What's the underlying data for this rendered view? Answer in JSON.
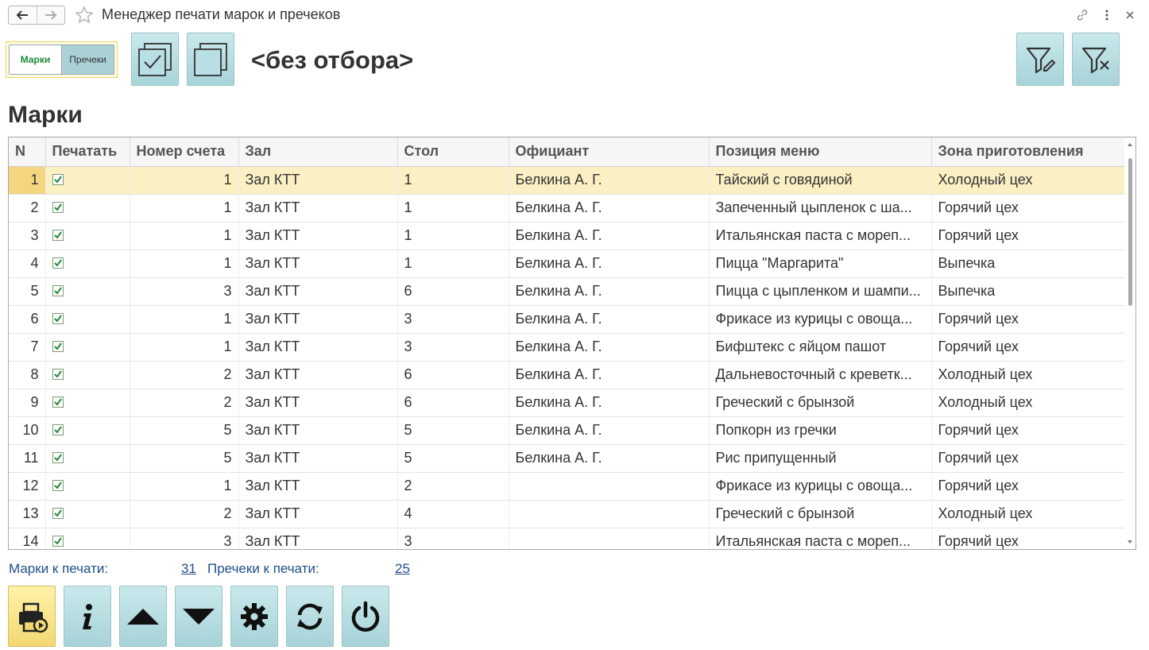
{
  "window": {
    "title": "Менеджер печати марок и пречеков"
  },
  "toolbar": {
    "toggle_marks": "Марки",
    "toggle_prechecks": "Пречеки",
    "filter_label": "<без отбора>"
  },
  "section": {
    "title": "Марки"
  },
  "table": {
    "columns": [
      "N",
      "Печатать",
      "Номер счета",
      "Зал",
      "Стол",
      "Официант",
      "Позиция меню",
      "Зона приготовления"
    ],
    "rows": [
      {
        "n": "1",
        "account": "1",
        "hall": "Зал КТТ",
        "table": "1",
        "waiter": "Белкина А. Г.",
        "item": "Тайский с говядиной",
        "zone": "Холодный цех"
      },
      {
        "n": "2",
        "account": "1",
        "hall": "Зал КТТ",
        "table": "1",
        "waiter": "Белкина А. Г.",
        "item": "Запеченный цыпленок с ша...",
        "zone": "Горячий цех"
      },
      {
        "n": "3",
        "account": "1",
        "hall": "Зал КТТ",
        "table": "1",
        "waiter": "Белкина А. Г.",
        "item": "Итальянская паста с мореп...",
        "zone": "Горячий цех"
      },
      {
        "n": "4",
        "account": "1",
        "hall": "Зал КТТ",
        "table": "1",
        "waiter": "Белкина А. Г.",
        "item": "Пицца \"Маргарита\"",
        "zone": "Выпечка"
      },
      {
        "n": "5",
        "account": "3",
        "hall": "Зал КТТ",
        "table": "6",
        "waiter": "Белкина А. Г.",
        "item": "Пицца с цыпленком и шампи...",
        "zone": "Выпечка"
      },
      {
        "n": "6",
        "account": "1",
        "hall": "Зал КТТ",
        "table": "3",
        "waiter": "Белкина А. Г.",
        "item": "Фрикасе из курицы с овоща...",
        "zone": "Горячий цех"
      },
      {
        "n": "7",
        "account": "1",
        "hall": "Зал КТТ",
        "table": "3",
        "waiter": "Белкина А. Г.",
        "item": "Бифштекс с яйцом пашот",
        "zone": "Горячий цех"
      },
      {
        "n": "8",
        "account": "2",
        "hall": "Зал КТТ",
        "table": "6",
        "waiter": "Белкина А. Г.",
        "item": "Дальневосточный с креветк...",
        "zone": "Холодный цех"
      },
      {
        "n": "9",
        "account": "2",
        "hall": "Зал КТТ",
        "table": "6",
        "waiter": "Белкина А. Г.",
        "item": "Греческий с брынзой",
        "zone": "Холодный цех"
      },
      {
        "n": "10",
        "account": "5",
        "hall": "Зал КТТ",
        "table": "5",
        "waiter": "Белкина А. Г.",
        "item": "Попкорн из гречки",
        "zone": "Горячий цех"
      },
      {
        "n": "11",
        "account": "5",
        "hall": "Зал КТТ",
        "table": "5",
        "waiter": "Белкина А. Г.",
        "item": "Рис припущенный",
        "zone": "Горячий цех"
      },
      {
        "n": "12",
        "account": "1",
        "hall": "Зал КТТ",
        "table": "2",
        "waiter": "",
        "item": "Фрикасе из курицы с овоща...",
        "zone": "Горячий цех"
      },
      {
        "n": "13",
        "account": "2",
        "hall": "Зал КТТ",
        "table": "4",
        "waiter": "",
        "item": "Греческий с брынзой",
        "zone": "Холодный цех"
      },
      {
        "n": "14",
        "account": "3",
        "hall": "Зал КТТ",
        "table": "3",
        "waiter": "",
        "item": "Итальянская паста с мореп...",
        "zone": "Горячий цех"
      }
    ]
  },
  "footer": {
    "marks_label": "Марки к печати:",
    "marks_count": "31",
    "prechecks_label": "Пречеки к печати:",
    "prechecks_count": "25"
  },
  "colors": {
    "button_bg": "#b8dfe3",
    "selected_row": "#fbefc4",
    "accent_yellow": "#f2d873",
    "check_green": "#1f8a3a",
    "link_blue": "#1f4e8c"
  }
}
